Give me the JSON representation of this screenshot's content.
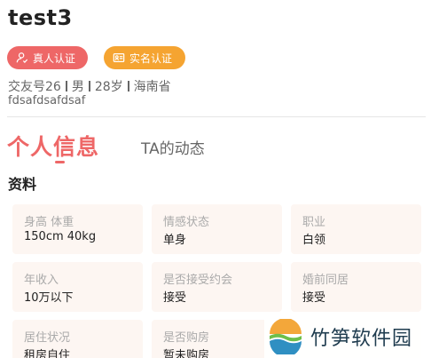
{
  "profile": {
    "username": "test3",
    "badges": {
      "real_person": "真人认证",
      "real_name": "实名认证"
    },
    "info": {
      "id_text": "交友号26",
      "gender": "男",
      "age": "28岁",
      "province": "海南省"
    },
    "signature": "fdsafdsafdsaf"
  },
  "tabs": {
    "active": "个人信息",
    "inactive": "TA的动态"
  },
  "section": {
    "title": "资料"
  },
  "details": [
    {
      "label": "身高 体重",
      "value": "150cm 40kg"
    },
    {
      "label": "情感状态",
      "value": "单身"
    },
    {
      "label": "职业",
      "value": "白领"
    },
    {
      "label": "年收入",
      "value": "10万以下"
    },
    {
      "label": "是否接受约会",
      "value": "接受"
    },
    {
      "label": "婚前同居",
      "value": "接受"
    },
    {
      "label": "居住状况",
      "value": "租房自住"
    },
    {
      "label": "是否购房",
      "value": "暂未购房"
    }
  ],
  "watermark": {
    "text": "竹笋软件园"
  },
  "colors": {
    "accent": "#ee6767",
    "orange": "#f5a431",
    "card_bg": "#fdf6f2"
  },
  "icons": {
    "real_person": "person-verified-icon",
    "real_name": "id-card-icon"
  }
}
